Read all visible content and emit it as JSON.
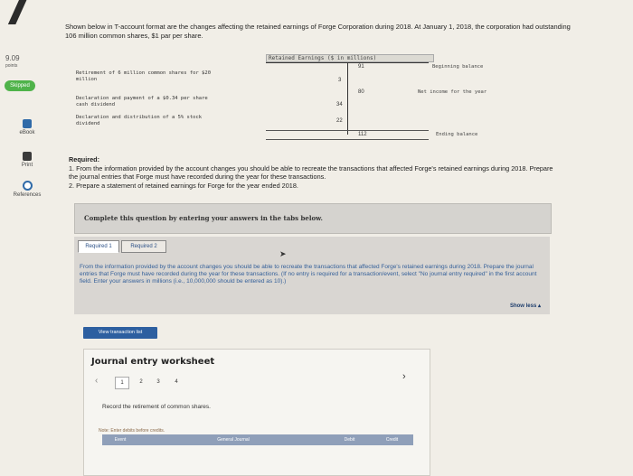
{
  "question_number": "7",
  "sidebar": {
    "points_value": "9.09",
    "points_label": "points",
    "skipped_badge": "Skipped",
    "items": [
      {
        "label": "eBook",
        "icon": "ebook-icon"
      },
      {
        "label": "Print",
        "icon": "print-icon"
      },
      {
        "label": "References",
        "icon": "references-icon"
      }
    ]
  },
  "problem_text": "Shown below in T-account format are the changes affecting the retained earnings of Forge Corporation during 2018. At January 1, 2018, the corporation had outstanding 106 million common shares, $1 par per share.",
  "t_account": {
    "title": "Retained Earnings ($ in millions)",
    "left_entries": [
      {
        "label": "Retirement of 6 million common shares for $20 million",
        "amount": "3"
      },
      {
        "label": "Declaration and payment of a $0.34 per share cash dividend",
        "amount": "34"
      },
      {
        "label": "Declaration and distribution of a 5% stock dividend",
        "amount": "22"
      }
    ],
    "right_entries": [
      {
        "amount": "91",
        "label": "Beginning balance"
      },
      {
        "amount": "80",
        "label": "Net income for the year"
      },
      {
        "amount": "112",
        "label": "Ending balance"
      }
    ]
  },
  "required": {
    "heading": "Required:",
    "item1": "1. From the information provided by the account changes you should be able to recreate the transactions that affected Forge's retained earnings during 2018. Prepare the journal entries that Forge must have recorded during the year for these transactions.",
    "item2": "2. Prepare a statement of retained earnings for Forge for the year ended 2018."
  },
  "complete_bar": "Complete this question by entering your answers in the tabs below.",
  "tabs": [
    {
      "label": "Required 1",
      "active": true
    },
    {
      "label": "Required 2",
      "active": false
    }
  ],
  "tab_instructions": "From the information provided by the account changes you should be able to recreate the transactions that affected Forge's retained earnings during 2018. Prepare the journal entries that Forge must have recorded during the year for these transactions. (If no entry is required for a transaction/event, select \"No journal entry required\" in the first account field. Enter your answers in millions (i.e., 10,000,000 should be entered as 10).)",
  "show_less": "Show less ▴",
  "view_transaction_button": "View transaction list",
  "worksheet": {
    "title": "Journal entry worksheet",
    "pages": [
      "1",
      "2",
      "3",
      "4"
    ],
    "current_page": "1",
    "instruction": "Record the retirement of common shares.",
    "note": "Note: Enter debits before credits.",
    "columns": [
      "Event",
      "General Journal",
      "Debit",
      "Credit"
    ]
  }
}
